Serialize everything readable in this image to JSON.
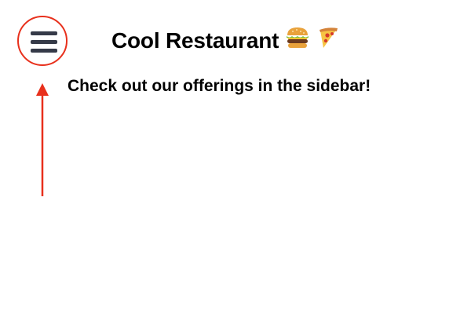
{
  "header": {
    "title": "Cool Restaurant",
    "title_emoji": [
      "burger-icon",
      "pizza-icon"
    ]
  },
  "main": {
    "message": "Check out our offerings in the sidebar!"
  },
  "menu_button": {
    "icon": "hamburger-menu-icon"
  },
  "annotation": {
    "highlight_color": "#e8301c",
    "arrow_color": "#e8301c"
  },
  "colors": {
    "icon": "#353a48",
    "text": "#000000",
    "background": "#ffffff"
  }
}
